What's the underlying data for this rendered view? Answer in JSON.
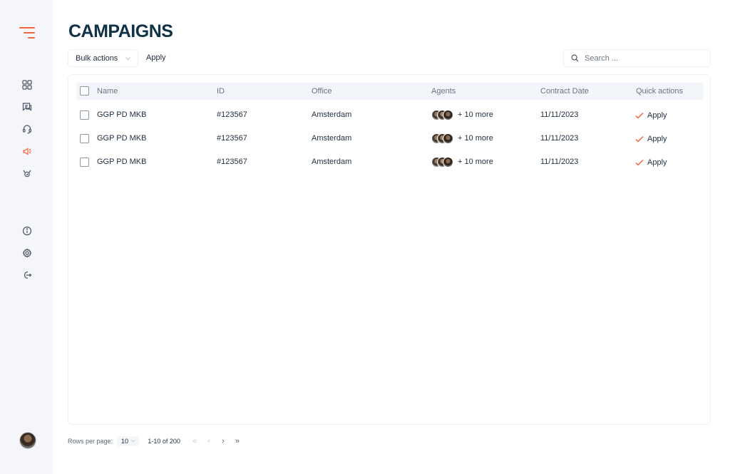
{
  "page": {
    "title": "CAMPAIGNS"
  },
  "toolbar": {
    "bulk_actions_label": "Bulk actions",
    "apply_label": "Apply",
    "search_placeholder": "Search ..."
  },
  "table": {
    "columns": {
      "name": "Name",
      "id": "ID",
      "office": "Office",
      "agents": "Agents",
      "contract_date": "Contract Date",
      "quick_actions": "Quick actions"
    },
    "rows": [
      {
        "name": "GGP PD MKB",
        "id": "#123567",
        "office": "Amsterdam",
        "agents_more": "+ 10 more",
        "contract_date": "11/11/2023",
        "action": "Apply"
      },
      {
        "name": "GGP PD MKB",
        "id": "#123567",
        "office": "Amsterdam",
        "agents_more": "+ 10 more",
        "contract_date": "11/11/2023",
        "action": "Apply"
      },
      {
        "name": "GGP PD MKB",
        "id": "#123567",
        "office": "Amsterdam",
        "agents_more": "+ 10 more",
        "contract_date": "11/11/2023",
        "action": "Apply"
      }
    ]
  },
  "pagination": {
    "rows_per_page_label": "Rows per page:",
    "rows_per_page_value": "10",
    "range_label": "1-10 of 200",
    "first": "«",
    "prev": "‹",
    "next": "›",
    "last": "»"
  },
  "sidebar": {
    "items": [
      {
        "icon": "dashboard-icon"
      },
      {
        "icon": "chat-icon"
      },
      {
        "icon": "headset-icon"
      },
      {
        "icon": "campaign-megaphone-icon",
        "active": true
      },
      {
        "icon": "badge-icon"
      }
    ],
    "bottom_items": [
      {
        "icon": "info-icon"
      },
      {
        "icon": "settings-icon"
      },
      {
        "icon": "logout-icon"
      }
    ]
  },
  "colors": {
    "accent": "#f2643c",
    "title": "#0f3247",
    "sidebar_bg": "#f4f6fa",
    "header_bg": "#f2f5f9"
  }
}
